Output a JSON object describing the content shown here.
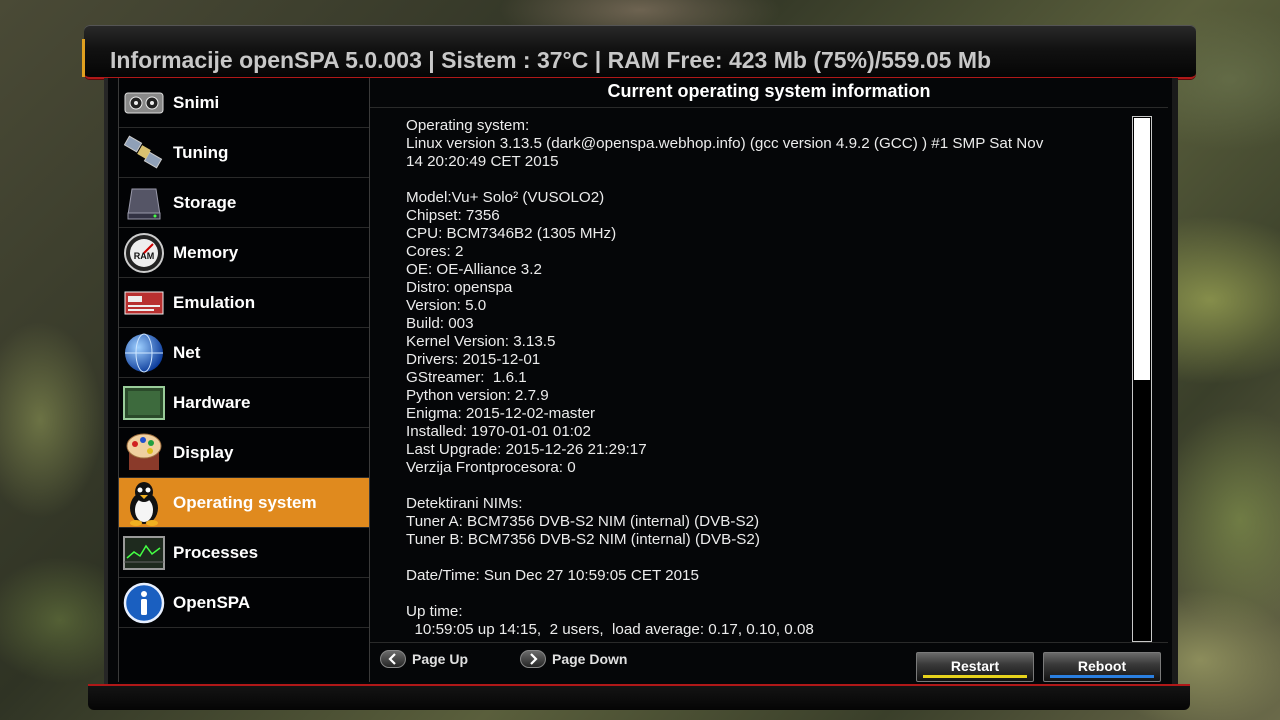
{
  "header": {
    "title": "Informacije openSPA 5.0.003 | Sistem : 37°C | RAM Free: 423 Mb (75%)/559.05 Mb"
  },
  "menu": [
    {
      "label": "Snimi",
      "icon": "recorder-icon",
      "selected": false
    },
    {
      "label": "Tuning",
      "icon": "satellite-icon",
      "selected": false
    },
    {
      "label": "Storage",
      "icon": "hard-drive-icon",
      "selected": false
    },
    {
      "label": "Memory",
      "icon": "ram-gauge-icon",
      "selected": false
    },
    {
      "label": "Emulation",
      "icon": "card-reader-icon",
      "selected": false
    },
    {
      "label": "Net",
      "icon": "globe-icon",
      "selected": false
    },
    {
      "label": "Hardware",
      "icon": "circuit-board-icon",
      "selected": false
    },
    {
      "label": "Display",
      "icon": "paint-palette-icon",
      "selected": false
    },
    {
      "label": "Operating system",
      "icon": "penguin-icon",
      "selected": true
    },
    {
      "label": "Processes",
      "icon": "monitor-graph-icon",
      "selected": false
    },
    {
      "label": "OpenSPA",
      "icon": "info-icon",
      "selected": false
    }
  ],
  "content": {
    "title": "Current operating system information",
    "lines": [
      "Operating system:",
      "Linux version 3.13.5 (dark@openspa.webhop.info) (gcc version 4.9.2 (GCC) ) #1 SMP Sat Nov",
      "14 20:20:49 CET 2015",
      "",
      "Model:Vu+ Solo² (VUSOLO2)",
      "Chipset: 7356",
      "CPU: BCM7346B2 (1305 MHz)",
      "Cores: 2",
      "OE: OE-Alliance 3.2",
      "Distro: openspa",
      "Version: 5.0",
      "Build: 003",
      "Kernel Version: 3.13.5",
      "Drivers: 2015-12-01",
      "GStreamer:  1.6.1",
      "Python version: 2.7.9",
      "Enigma: 2015-12-02-master",
      "Installed: 1970-01-01 01:02",
      "Last Upgrade: 2015-12-26 21:29:17",
      "Verzija Frontprocesora: 0",
      "",
      "Detektirani NIMs:",
      "Tuner A: BCM7356 DVB-S2 NIM (internal) (DVB-S2)",
      "Tuner B: BCM7356 DVB-S2 NIM (internal) (DVB-S2)",
      "",
      "Date/Time: Sun Dec 27 10:59:05 CET 2015",
      "",
      "Up time:",
      "  10:59:05 up 14:15,  2 users,  load average: 0.17, 0.10, 0.08"
    ]
  },
  "footer": {
    "page_up": "Page Up",
    "page_down": "Page Down",
    "restart": "Restart",
    "reboot": "Reboot"
  },
  "colors": {
    "selected": "#e08a1e",
    "header_accent": "#b01818",
    "restart_stripe": "#e6d21c",
    "reboot_stripe": "#2a7fe0"
  }
}
